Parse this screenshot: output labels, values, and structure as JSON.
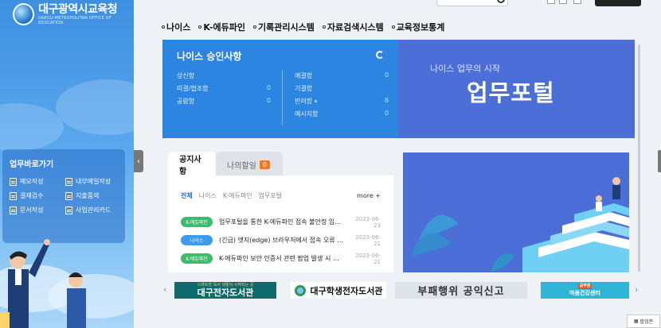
{
  "header": {
    "org_name": "대구광역시교육청",
    "org_name_en": "DAEGU METROPOLITAN OFFICE OF EDUCATION"
  },
  "sidebar": {
    "shortcut_title": "업무바로가기",
    "shortcuts": [
      {
        "label": "메모작성",
        "icon": "doc-icon"
      },
      {
        "label": "내부메일작성",
        "icon": "doc-icon"
      },
      {
        "label": "결재검수",
        "icon": "doc-icon"
      },
      {
        "label": "지출품의",
        "icon": "doc-icon"
      },
      {
        "label": "문서작성",
        "icon": "doc-icon"
      },
      {
        "label": "사업관리카드",
        "icon": "doc-icon"
      }
    ],
    "toggle_glyph": "‹"
  },
  "quick_menu": [
    "나이스",
    "K-에듀파인",
    "기록관리시스템",
    "자료검색시스템",
    "교육정보통계"
  ],
  "approval": {
    "title": "나이스 승인사항",
    "left": [
      {
        "label": "상신함",
        "value": ""
      },
      {
        "label": "미결/협조함",
        "value": "0"
      },
      {
        "label": "공람함",
        "value": "0"
      }
    ],
    "right": [
      {
        "label": "예결함",
        "value": "0"
      },
      {
        "label": "기결함",
        "value": ""
      },
      {
        "label": "반려함",
        "value": "8"
      },
      {
        "label": "예시지함",
        "value": "0"
      }
    ]
  },
  "portal": {
    "subtitle": "나이스 업무의 시작",
    "title": "업무포털"
  },
  "notice": {
    "tab_notice": "공지사항",
    "tab_todo": "나의할일",
    "todo_count": "0",
    "filters": [
      "전체",
      "나이스",
      "K-에듀파인",
      "업무포털"
    ],
    "more": "more +",
    "items": [
      {
        "badge": "K-에듀파인",
        "badge_color": "#3dbb6e",
        "title": "업무포털을 통한 K-에듀파인 접속 불안정 임시 조...",
        "date": "2023-06-23"
      },
      {
        "badge": "나이스",
        "badge_color": "#3d9bea",
        "title": "(긴급) 엣지(edge) 브라우저에서 접속 오류 시 조...",
        "date": "2023-06-21"
      },
      {
        "badge": "K-에듀파인",
        "badge_color": "#3dbb6e",
        "title": "K-에듀파인 보안 인증서 관련 팝업 발생 시 조치...",
        "date": "2023-06-21"
      }
    ]
  },
  "banners": {
    "b1_small": "스마트한 독서 생활이 시작되는 곳",
    "b1_big": "대구전자도서관",
    "b2": "대구학생전자도서관",
    "b3": "부패행위 공익신고",
    "b4_small": "공무원",
    "b4_big": "마음건강센터",
    "prev": "‹",
    "next": "›"
  },
  "popup_button": "팝업존",
  "colors": {
    "approval_bg": "#2c86e1",
    "portal_bg": "#4b6fd6",
    "badge_green": "#3dbb6e",
    "badge_blue": "#3d9bea",
    "todo_badge": "#f07820"
  }
}
